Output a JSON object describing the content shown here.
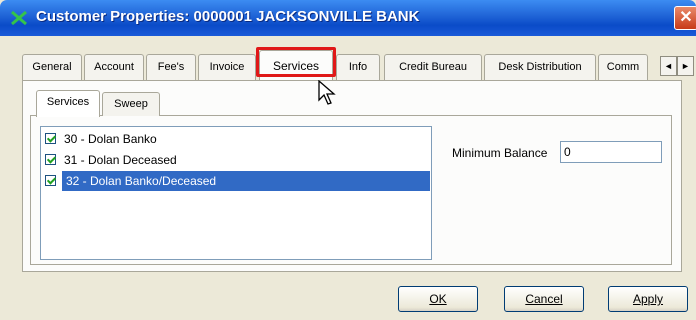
{
  "window": {
    "title": "Customer Properties: 0000001 JACKSONVILLE BANK",
    "close_glyph": "✕",
    "accent": "#0a4bc8"
  },
  "outer_tabs": [
    {
      "label": "General"
    },
    {
      "label": "Account"
    },
    {
      "label": "Fee's"
    },
    {
      "label": "Invoice"
    },
    {
      "label": "Services",
      "active": true
    },
    {
      "label": "Info"
    },
    {
      "label": "Credit Bureau"
    },
    {
      "label": "Desk Distribution"
    },
    {
      "label": "Comm"
    }
  ],
  "tab_scroll": {
    "left_glyph": "◄",
    "right_glyph": "►"
  },
  "inner_tabs": [
    {
      "label": "Services",
      "active": true
    },
    {
      "label": "Sweep"
    }
  ],
  "services_list": [
    {
      "label": "30 - Dolan Banko",
      "checked": true
    },
    {
      "label": "31 - Dolan Deceased",
      "checked": true
    },
    {
      "label": "32 - Dolan Banko/Deceased",
      "checked": true,
      "selected": true
    }
  ],
  "minimum_balance": {
    "label": "Minimum Balance",
    "value": "0"
  },
  "buttons": {
    "ok": "OK",
    "cancel": "Cancel",
    "apply": "Apply"
  },
  "highlight_color": "#e01818"
}
